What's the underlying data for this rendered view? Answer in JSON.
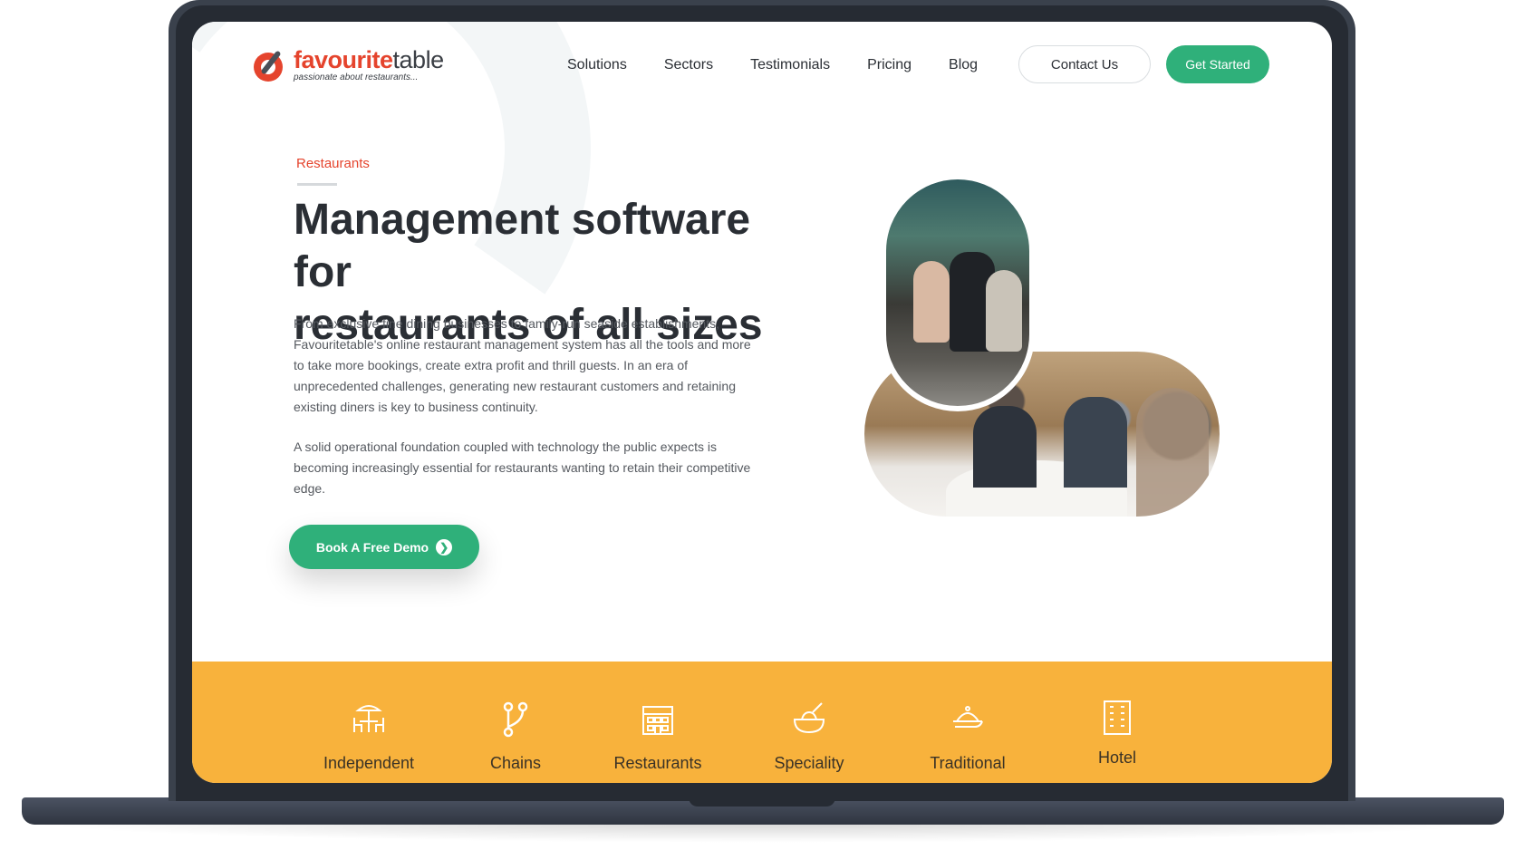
{
  "header": {
    "logo": {
      "word_a": "favourite",
      "word_b": "table",
      "tagline": "passionate about restaurants..."
    },
    "nav": [
      "Solutions",
      "Sectors",
      "Testimonials",
      "Pricing",
      "Blog"
    ],
    "contact_label": "Contact Us",
    "get_started_label": "Get Started"
  },
  "hero": {
    "eyebrow": "Restaurants",
    "headline_line1": "Management software for",
    "headline_strong": "restaurants",
    "headline_rest": " of all sizes",
    "paragraph1": "From exclusive fine dining businesses to family-run seaside establishments, Favouritetable's online restaurant management system has all the tools and more to take more bookings, create extra profit and thrill guests. In an era of unprecedented challenges, generating new restaurant customers and retaining existing diners is key to business continuity.",
    "paragraph2": "A solid operational foundation coupled with technology the public expects is becoming increasingly essential for restaurants wanting to retain their competitive edge.",
    "demo_button_label": "Book A Free Demo",
    "demo_button_icon": "chevron-right-icon"
  },
  "sectors": [
    {
      "label": "Independent",
      "icon": "outdoor-table-icon"
    },
    {
      "label": "Chains",
      "icon": "branch-icon"
    },
    {
      "label": "Restaurants",
      "icon": "building-icon"
    },
    {
      "label": "Speciality",
      "icon": "bowl-icon"
    },
    {
      "label": "Traditional",
      "icon": "cloche-icon"
    },
    {
      "label": "Hotel",
      "icon": "hotel-icon"
    }
  ],
  "colors": {
    "brand_red": "#e5442d",
    "brand_green": "#2fb07a",
    "band_orange": "#f8b23c",
    "text_dark": "#2a2e34"
  }
}
